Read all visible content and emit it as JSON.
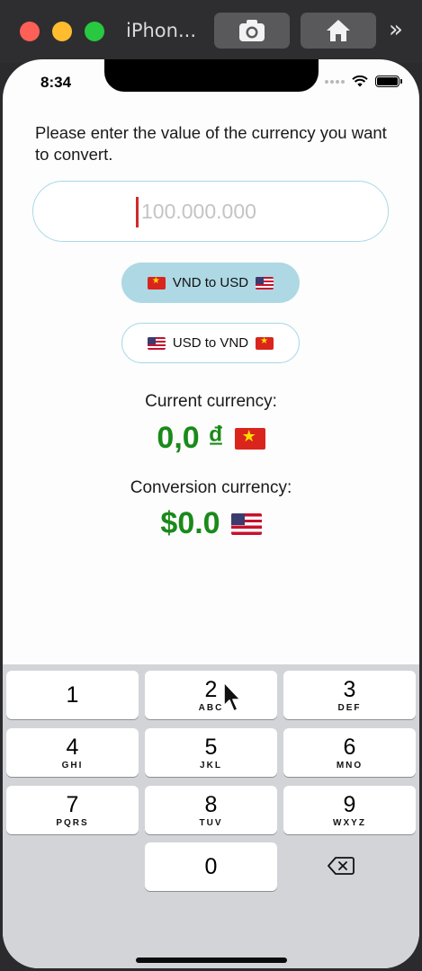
{
  "window": {
    "title": "iPhon...",
    "screenshot_icon": "camera-icon",
    "home_icon": "home-icon",
    "more_label": "»"
  },
  "status_bar": {
    "time": "8:34",
    "wifi_icon": "wifi-icon",
    "battery_icon": "battery-icon"
  },
  "main": {
    "prompt": "Please enter the value of the currency you want to convert.",
    "amount_placeholder": "100.000.000",
    "amount_value": "",
    "buttons": {
      "vnd_to_usd": "VND to USD",
      "usd_to_vnd": "USD to VND"
    },
    "current_label": "Current currency:",
    "current_value": "0,0 ₫",
    "conversion_label": "Conversion currency:",
    "conversion_value": "$0.0"
  },
  "keyboard": {
    "keys": [
      {
        "num": "1",
        "letters": ""
      },
      {
        "num": "2",
        "letters": "ABC"
      },
      {
        "num": "3",
        "letters": "DEF"
      },
      {
        "num": "4",
        "letters": "GHI"
      },
      {
        "num": "5",
        "letters": "JKL"
      },
      {
        "num": "6",
        "letters": "MNO"
      },
      {
        "num": "7",
        "letters": "PQRS"
      },
      {
        "num": "8",
        "letters": "TUV"
      },
      {
        "num": "9",
        "letters": "WXYZ"
      },
      {
        "num": "0",
        "letters": ""
      }
    ],
    "delete_icon": "backspace-icon"
  },
  "colors": {
    "accent_fill": "#add8e4",
    "accent_border": "#a8d8e6",
    "value_green": "#1a8a1a",
    "caret_red": "#d12a2a"
  }
}
